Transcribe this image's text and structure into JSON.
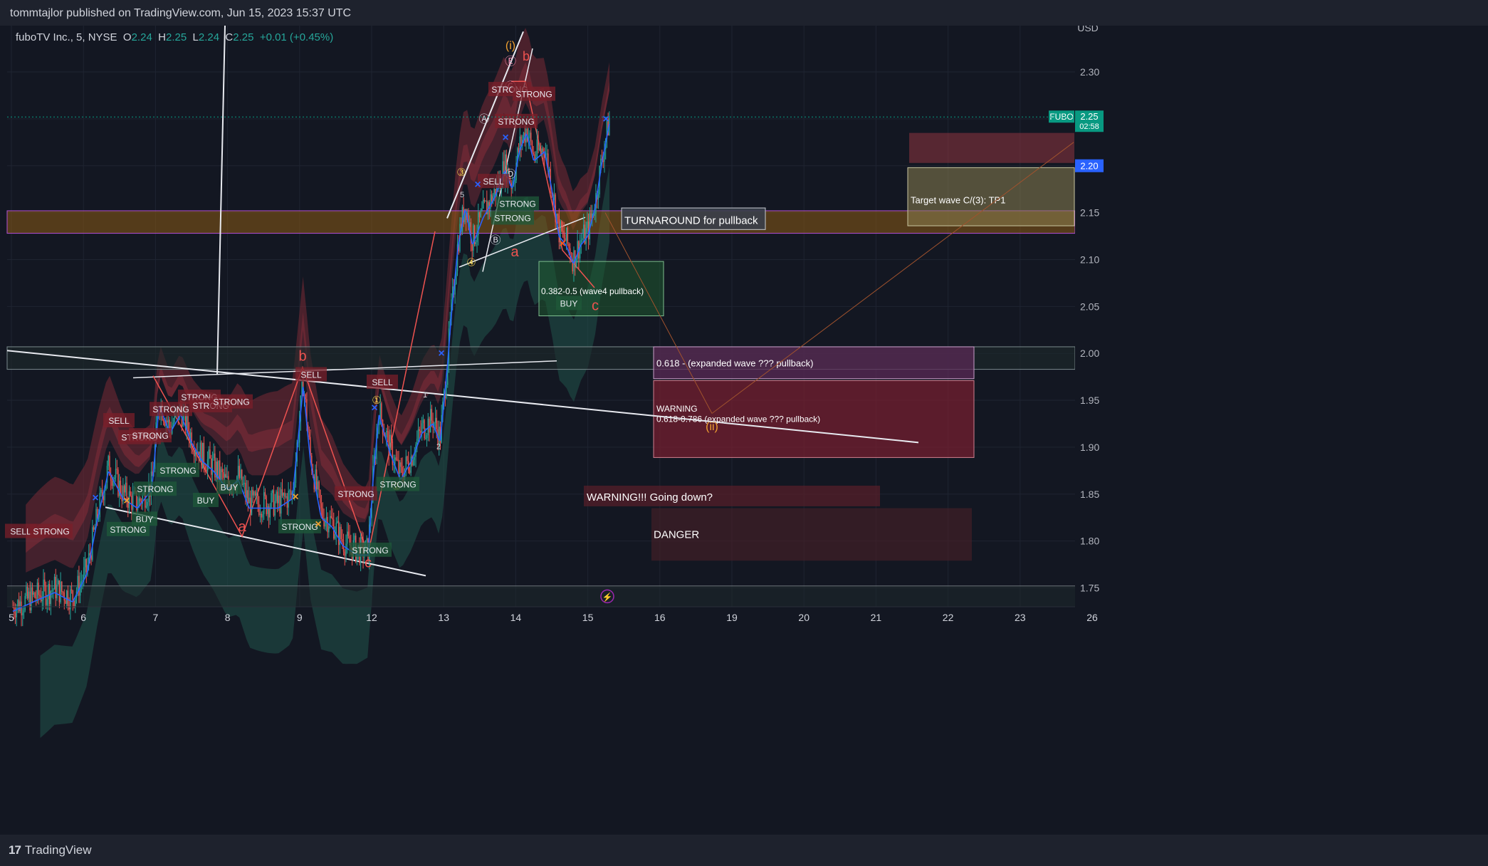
{
  "header": {
    "published": "tommtajlor published on TradingView.com, Jun 15, 2023 15:37 UTC"
  },
  "footer": {
    "brand": "TradingView",
    "logo": "17"
  },
  "legend": {
    "symbol": "fuboTV Inc., 5, NYSE",
    "o_label": "O",
    "o": "2.24",
    "h_label": "H",
    "h": "2.25",
    "l_label": "L",
    "l": "2.24",
    "c_label": "C",
    "c": "2.25",
    "change": "+0.01 (+0.45%)"
  },
  "colors": {
    "background": "#131722",
    "up": "#26a69a",
    "down": "#ef5350",
    "ma_line": "#2962ff",
    "red_band": "#7a2a34",
    "green_band": "#1f4f47"
  },
  "chart_data": {
    "type": "line",
    "currency": "USD",
    "ylim": [
      1.73,
      2.35
    ],
    "y_ticks": [
      "2.30",
      "2.25",
      "2.20",
      "2.15",
      "2.10",
      "2.05",
      "2.00",
      "1.95",
      "1.90",
      "1.85",
      "1.80",
      "1.75"
    ],
    "x_ticks": [
      "5",
      "6",
      "7",
      "8",
      "9",
      "12",
      "13",
      "14",
      "15",
      "16",
      "19",
      "20",
      "21",
      "22",
      "23",
      "26"
    ],
    "x_tick_index": [
      0,
      1,
      2,
      3,
      4,
      5,
      6,
      7,
      8,
      9,
      10,
      11,
      12,
      13,
      14,
      15
    ],
    "series": [
      {
        "x": [
          0.02,
          0.3,
          0.6,
          0.85,
          1.05,
          1.2,
          1.35,
          1.55,
          1.75,
          1.95,
          2.05,
          2.2,
          2.35,
          2.5,
          2.65,
          2.8,
          3.0,
          3.15,
          3.3,
          3.5,
          3.7,
          3.9,
          4.05,
          4.15,
          4.3,
          4.45,
          4.6,
          4.8,
          4.95,
          5.02,
          5.1,
          5.25,
          5.4,
          5.55,
          5.7,
          5.85,
          5.95,
          6.05,
          6.1,
          6.2,
          6.3,
          6.4,
          6.55,
          6.7,
          6.85,
          6.95,
          7.05,
          7.15,
          7.25,
          7.4,
          7.5,
          7.6,
          7.7,
          7.8,
          7.9,
          8.0,
          8.1,
          8.2,
          8.3
        ],
        "values": [
          1.73,
          1.74,
          1.75,
          1.74,
          1.77,
          1.83,
          1.88,
          1.85,
          1.84,
          1.86,
          1.95,
          1.92,
          1.94,
          1.91,
          1.89,
          1.88,
          1.86,
          1.87,
          1.84,
          1.84,
          1.84,
          1.85,
          1.97,
          1.89,
          1.83,
          1.82,
          1.8,
          1.79,
          1.79,
          1.87,
          1.94,
          1.9,
          1.87,
          1.89,
          1.92,
          1.93,
          1.91,
          1.99,
          2.04,
          2.12,
          2.16,
          2.12,
          2.15,
          2.17,
          2.2,
          2.18,
          2.22,
          2.24,
          2.21,
          2.22,
          2.18,
          2.13,
          2.12,
          2.1,
          2.12,
          2.13,
          2.16,
          2.21,
          2.25
        ]
      }
    ],
    "wave_labels": [
      "(i)",
      "b",
      "Ⓒ",
      "Ⓔ",
      "Ⓐ",
      "Ⓓ",
      "Ⓑ",
      "③",
      "④",
      "5",
      "a",
      "c",
      "b",
      "a",
      "c",
      "①",
      "②",
      "1",
      "2",
      "(ii)"
    ],
    "signals": [
      "SELL",
      "STRONG",
      "SELL",
      "STRONG",
      "STRONG",
      "STRONG",
      "STRONG",
      "STRONG",
      "STRONG",
      "STRONG",
      "BUY",
      "BUY",
      "BUY",
      "STRONG",
      "STRONG",
      "STRONG",
      "STRONG",
      "SELL",
      "SELL",
      "STRONG",
      "STRONG",
      "STRONG",
      "STRONG",
      "STRONG",
      "STRONG",
      "SELL",
      "BUY",
      "STRONG"
    ],
    "zones": {
      "turnaround": "TURNAROUND for pullback",
      "wave4": "0.382-0.5 (wave4 pullback)",
      "fib618": "0.618 - (expanded wave ??? pullback)",
      "warning1": "WARNING",
      "warning2": "0.618-0.786  (expanded wave ??? pullback)",
      "warning_down": "WARNING!!! Going down?",
      "danger": "DANGER",
      "target": "Target wave C/(3): TP1"
    },
    "price_tags": {
      "symbol": "FUBO",
      "last": "2.25",
      "countdown": "02:58",
      "level": "2.20"
    }
  }
}
